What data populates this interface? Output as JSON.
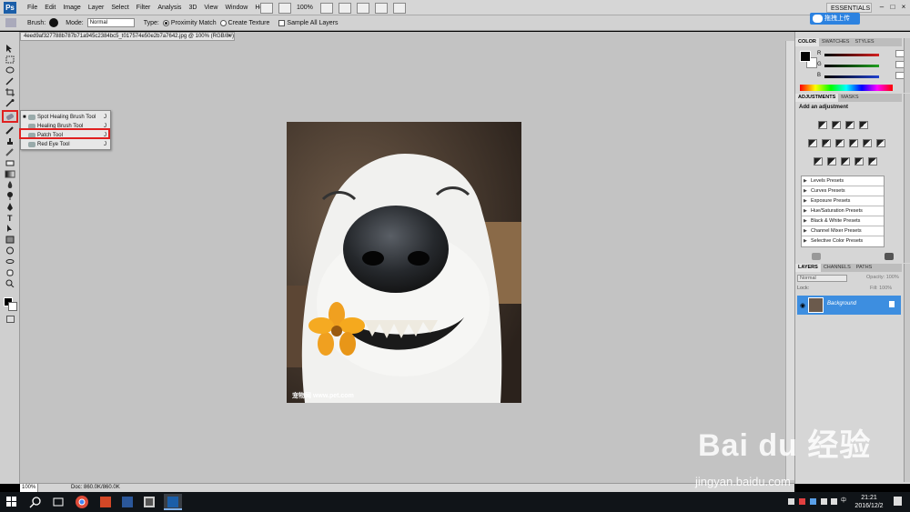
{
  "app": {
    "logo": "Ps",
    "menu": [
      "File",
      "Edit",
      "Image",
      "Layer",
      "Select",
      "Filter",
      "Analysis",
      "3D",
      "View",
      "Window",
      "Help"
    ],
    "zoom_display": "100%",
    "workspace": "ESSENTIALS"
  },
  "options_bar": {
    "brush_label": "Brush:",
    "brush_size": "19",
    "mode_label": "Mode:",
    "mode_value": "Normal",
    "type_label": "Type:",
    "proximity_match": "Proximity Match",
    "create_texture": "Create Texture",
    "sample_all_layers": "Sample All Layers"
  },
  "baidu_upload_button": "拖拽上传",
  "document": {
    "tab_title": "4eed9af327788b787b71a945c2384bc5_t017574e50e2b7a7642.jpg @ 100% (RGB/8#)",
    "status_zoom": "100%",
    "status_doc": "Doc: 860.0K/860.0K",
    "photo_watermark": "宠物网 www.pet.com"
  },
  "tool_flyout": {
    "items": [
      {
        "label": "Spot Healing Brush Tool",
        "key": "J",
        "selected": true
      },
      {
        "label": "Healing Brush Tool",
        "key": "J",
        "selected": false
      },
      {
        "label": "Patch Tool",
        "key": "J",
        "selected": false
      },
      {
        "label": "Red Eye Tool",
        "key": "J",
        "selected": false
      }
    ]
  },
  "color_panel": {
    "tabs": [
      "COLOR",
      "SWATCHES",
      "STYLES"
    ],
    "channels": [
      {
        "label": "R",
        "value": "0",
        "color": "#d42020"
      },
      {
        "label": "G",
        "value": "0",
        "color": "#20a020"
      },
      {
        "label": "B",
        "value": "0",
        "color": "#2040d0"
      }
    ]
  },
  "adjustments_panel": {
    "tabs": [
      "ADJUSTMENTS",
      "MASKS"
    ],
    "title": "Add an adjustment",
    "presets": [
      "Levels Presets",
      "Curves Presets",
      "Exposure Presets",
      "Hue/Saturation Presets",
      "Black & White Presets",
      "Channel Mixer Presets",
      "Selective Color Presets"
    ]
  },
  "layers_panel": {
    "tabs": [
      "LAYERS",
      "CHANNELS",
      "PATHS"
    ],
    "blend_mode": "Normal",
    "opacity_label": "Opacity:",
    "lock_label": "Lock:",
    "fill_label": "Fill:",
    "opacity_value": "100%",
    "fill_value": "100%",
    "layer_name": "Background"
  },
  "watermark": {
    "brand": "Bai du 经验",
    "url": "jingyan.baidu.com"
  },
  "taskbar": {
    "time": "21:21",
    "date": "2016/12/2"
  },
  "colors": {
    "highlight": "#e02020",
    "selection": "#3d8ee0",
    "canvas_bg": "#c3c3c3"
  }
}
